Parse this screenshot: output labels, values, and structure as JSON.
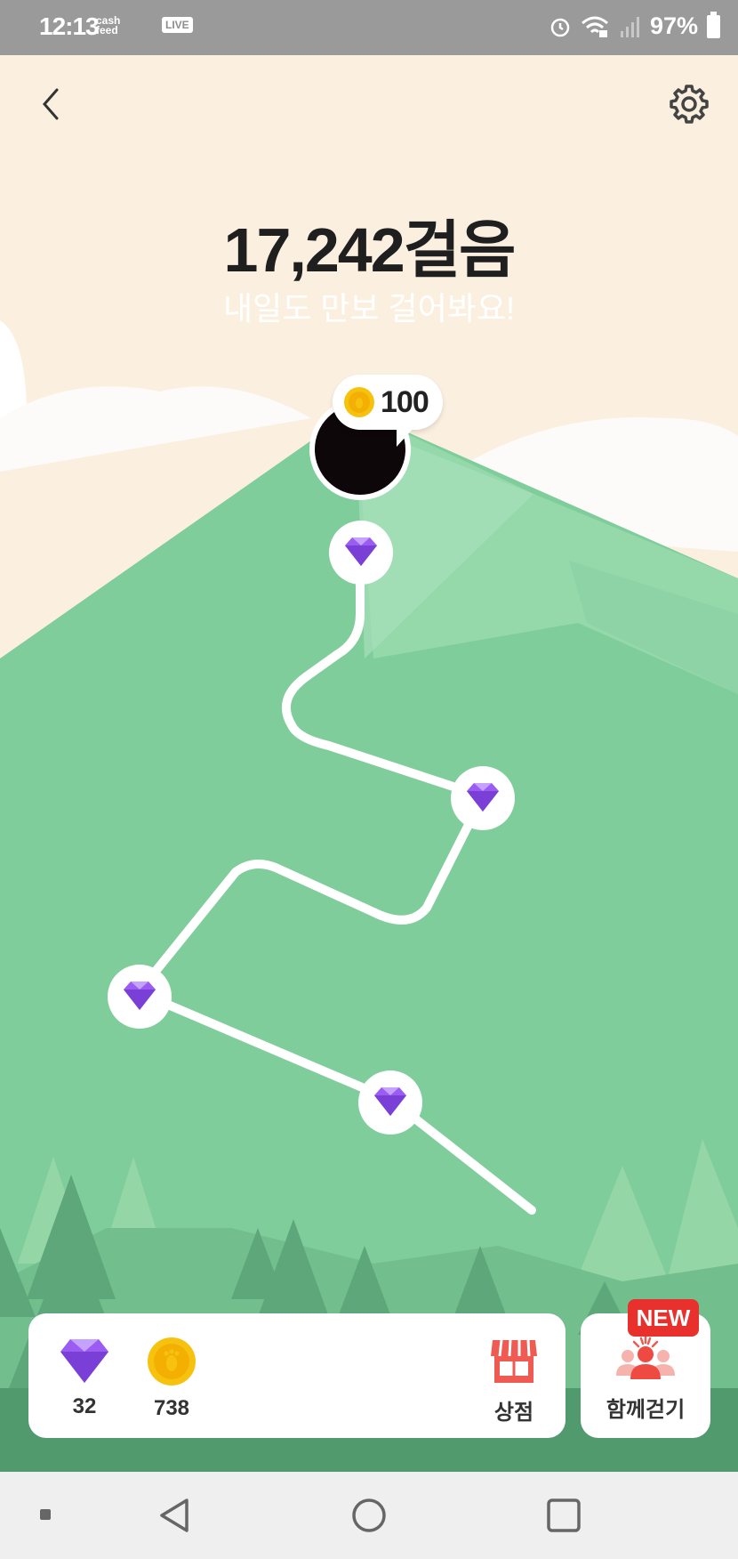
{
  "status_bar": {
    "time": "12:13",
    "app_label": "cash feed",
    "live_label": "LIVE",
    "battery": "97%"
  },
  "header": {
    "back_icon": "chevron-left-icon",
    "settings_icon": "gear-icon"
  },
  "steps": {
    "count": "17,242걸음",
    "message": "내일도 만보 걸어봐요!"
  },
  "summit_reward": {
    "icon": "coin-icon",
    "value": "100"
  },
  "path_nodes": [
    "gem-icon",
    "gem-icon",
    "gem-icon",
    "gem-icon"
  ],
  "inventory": {
    "gems": "32",
    "coins": "738",
    "shop_label": "상점"
  },
  "walk_together": {
    "label": "함께걷기",
    "badge": "NEW"
  },
  "colors": {
    "sky": "#fbf0e0",
    "mountain": "#80cd9c",
    "gem": "#9b5cf2",
    "coin": "#f7c20e",
    "badge": "#e8312c"
  }
}
